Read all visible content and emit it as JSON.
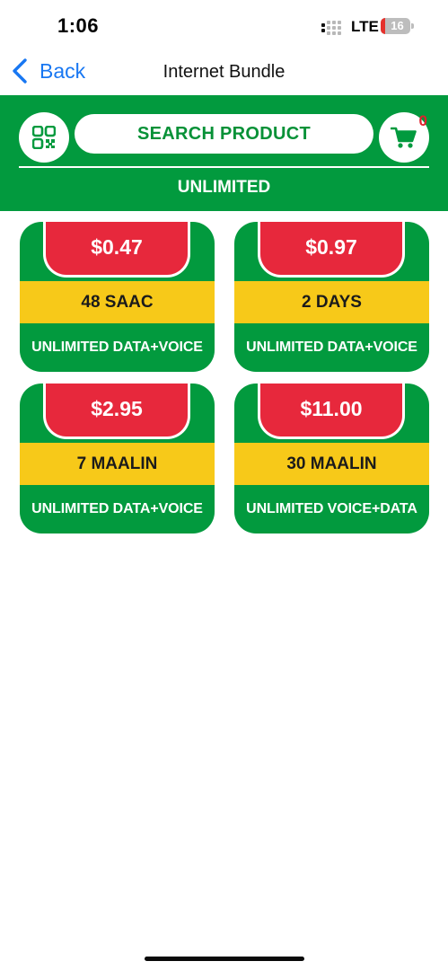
{
  "status_bar": {
    "time": "1:06",
    "network": "LTE",
    "battery_level": "16"
  },
  "nav": {
    "back_label": "Back",
    "title": "Internet Bundle"
  },
  "header": {
    "search_label": "SEARCH PRODUCT",
    "cart_count": "0",
    "category": "UNLIMITED"
  },
  "colors": {
    "brand_green": "#029a3e",
    "price_red": "#e7283c",
    "band_yellow": "#f7c919",
    "link_blue": "#1877f2"
  },
  "products": [
    {
      "price": "$0.47",
      "duration": "48 SAAC",
      "description": "UNLIMITED DATA+VOICE"
    },
    {
      "price": "$0.97",
      "duration": "2 DAYS",
      "description": "UNLIMITED DATA+VOICE"
    },
    {
      "price": "$2.95",
      "duration": "7 MAALIN",
      "description": "UNLIMITED DATA+VOICE"
    },
    {
      "price": "$11.00",
      "duration": "30 MAALIN",
      "description": "UNLIMITED VOICE+DATA"
    }
  ]
}
